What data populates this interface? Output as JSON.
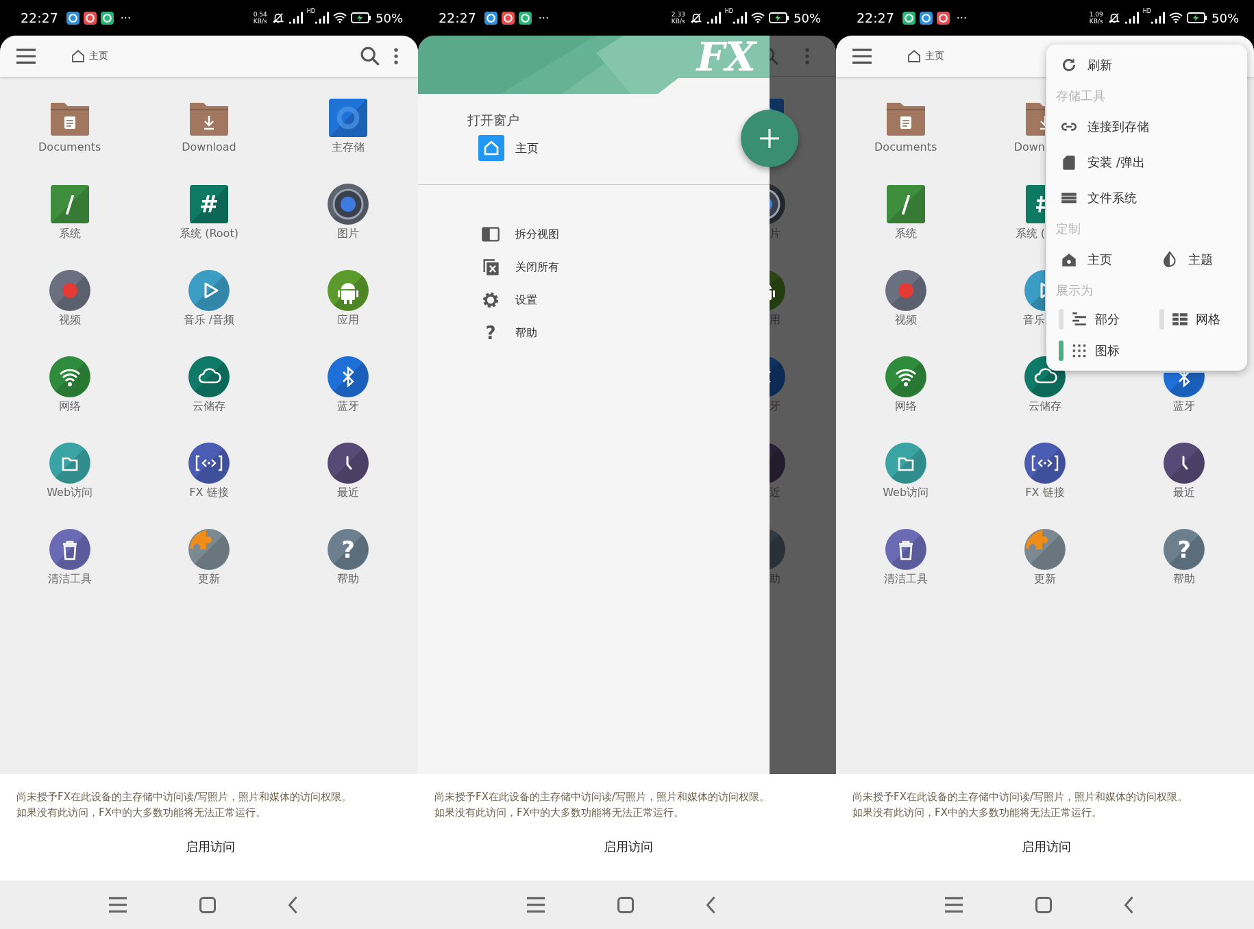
{
  "screens": [
    {
      "kind": "home",
      "status_bar": {
        "time": "22:27",
        "notifications": [
          {
            "kind": "browser"
          },
          {
            "kind": "qq"
          },
          {
            "kind": "cleaner"
          }
        ],
        "more": "···",
        "speed_value": "0.54",
        "speed_unit": "KB/s",
        "network_label": "HD",
        "battery": "50%"
      },
      "app_bar": {
        "title": "主页"
      },
      "grid": {
        "columns": [
          [
            {
              "label": "Documents",
              "kind": "folder-doc",
              "color": "#a1775f"
            },
            {
              "label": "系统",
              "kind": "tile-slash",
              "color": "#3e8e3e",
              "glyph": "/"
            },
            {
              "label": "视频",
              "kind": "circle-record",
              "color": "#6b7080"
            },
            {
              "label": "网络",
              "kind": "circle-wifi",
              "color": "#2f8c3c"
            },
            {
              "label": "Web访问",
              "kind": "circle-folder",
              "color": "#3aa3a3"
            },
            {
              "label": "清洁工具",
              "kind": "circle-trash",
              "color": "#6b6bb5"
            }
          ],
          [
            {
              "label": "Download",
              "kind": "folder-download",
              "color": "#a1775f"
            },
            {
              "label": "系统 (Root)",
              "kind": "tile-hash",
              "color": "#0e7a63",
              "glyph": "#"
            },
            {
              "label": "音乐 /音频",
              "kind": "circle-play",
              "color": "#3b9cc4"
            },
            {
              "label": "云储存",
              "kind": "circle-cloud",
              "color": "#0f7a68"
            },
            {
              "label": "FX 链接",
              "kind": "circle-code",
              "color": "#4a5db3"
            },
            {
              "label": "更新",
              "kind": "circle-puzzle",
              "color": "#7b8a92"
            }
          ],
          [
            {
              "label": "主存储",
              "kind": "tile-storage",
              "color": "#1f72d6"
            },
            {
              "label": "图片",
              "kind": "circle-camera",
              "color": "#5c6470"
            },
            {
              "label": "应用",
              "kind": "circle-android",
              "color": "#5b9b2b"
            },
            {
              "label": "蓝牙",
              "kind": "circle-bluetooth",
              "color": "#1f6fd8"
            },
            {
              "label": "最近",
              "kind": "circle-clock",
              "color": "#584a77"
            },
            {
              "label": "帮助",
              "kind": "circle-question",
              "color": "#6b7f8f",
              "glyph": "?"
            }
          ]
        ]
      },
      "banner": {
        "message_lines": [
          "尚未授予FX在此设备的主存储中访问读/写照片，照片和媒体的访问权限。",
          "如果没有此访问，FX中的大多数功能将无法正常运行。"
        ],
        "button": "启用访问"
      }
    },
    {
      "kind": "drawer",
      "status_bar": {
        "time": "22:27",
        "notifications": [
          {
            "kind": "browser"
          },
          {
            "kind": "qq"
          },
          {
            "kind": "cleaner"
          }
        ],
        "more": "···",
        "speed_value": "2.33",
        "speed_unit": "KB/s",
        "network_label": "HD",
        "battery": "50%"
      },
      "drawer": {
        "logo": "FX",
        "section": "打开窗户",
        "windows": [
          {
            "label": "主页"
          }
        ],
        "actions": [
          {
            "kind": "split",
            "label": "拆分视图"
          },
          {
            "kind": "close-all",
            "label": "关闭所有"
          },
          {
            "kind": "gear",
            "label": "设置"
          },
          {
            "kind": "help",
            "glyph": "?",
            "label": "帮助"
          }
        ]
      },
      "background_column": [
        {
          "kind": "tile-storage",
          "color": "#0e3360"
        },
        {
          "kind": "circle-camera",
          "color": "#292d32",
          "label": "片"
        },
        {
          "kind": "circle-android",
          "color": "#294613",
          "label": "用"
        },
        {
          "kind": "circle-bluetooth",
          "color": "#0e3261",
          "label": "牙"
        },
        {
          "kind": "circle-clock",
          "color": "#282135",
          "label": "近"
        },
        {
          "kind": "circle-question",
          "color": "#303940",
          "label": "助"
        }
      ],
      "banner": {
        "message_lines": [
          "尚未授予FX在此设备的主存储中访问读/写照片，照片和媒体的访问权限。",
          "如果没有此访问，FX中的大多数功能将无法正常运行。"
        ],
        "button": "启用访问"
      }
    },
    {
      "kind": "menu",
      "status_bar": {
        "time": "22:27",
        "notifications": [
          {
            "kind": "cleaner"
          },
          {
            "kind": "browser"
          },
          {
            "kind": "qq"
          }
        ],
        "more": "···",
        "speed_value": "1.09",
        "speed_unit": "KB/s",
        "network_label": "HD",
        "battery": "50%"
      },
      "app_bar": {
        "title": "主页"
      },
      "grid": {
        "columns": [
          [
            {
              "label": "Documents",
              "kind": "folder-doc",
              "color": "#a1775f"
            },
            {
              "label": "系统",
              "kind": "tile-slash",
              "color": "#3e8e3e",
              "glyph": "/"
            },
            {
              "label": "视频",
              "kind": "circle-record",
              "color": "#6b7080"
            },
            {
              "label": "网络",
              "kind": "circle-wifi",
              "color": "#2f8c3c"
            },
            {
              "label": "Web访问",
              "kind": "circle-folder",
              "color": "#3aa3a3"
            },
            {
              "label": "清洁工具",
              "kind": "circle-trash",
              "color": "#6b6bb5"
            }
          ],
          [
            {
              "label": "Down",
              "kind": "folder-download",
              "color": "#a1775f"
            },
            {
              "label": "系统 (",
              "kind": "tile-hash",
              "color": "#0e7a63"
            },
            {
              "label": "音乐",
              "kind": "circle-play",
              "color": "#3b9cc4"
            },
            {
              "label": "云储存",
              "kind": "circle-cloud",
              "color": "#0f7a68"
            },
            {
              "label": "FX 链接",
              "kind": "circle-code",
              "color": "#4a5db3"
            },
            {
              "label": "更新",
              "kind": "circle-puzzle",
              "color": "#7b8a92"
            }
          ],
          [
            {
              "label": "蓝牙",
              "kind": "circle-bluetooth",
              "color": "#1f6fd8"
            },
            {
              "label": "最近",
              "kind": "circle-clock",
              "color": "#584a77"
            },
            {
              "label": "帮助",
              "kind": "circle-question",
              "color": "#6b7f8f",
              "glyph": "?"
            }
          ]
        ]
      },
      "menu": [
        {
          "kind": "refresh",
          "label": "刷新"
        },
        {
          "kind": "header",
          "label": "存储工具"
        },
        {
          "kind": "link",
          "label": "连接到存储"
        },
        {
          "kind": "sd-card",
          "label": "安装 /弹出"
        },
        {
          "kind": "storage",
          "label": "文件系统"
        },
        {
          "kind": "header",
          "label": "定制"
        },
        {
          "kind": "row",
          "items": [
            {
              "kind": "home-gear",
              "label": "主页"
            },
            {
              "kind": "drop",
              "label": "主题"
            }
          ]
        },
        {
          "kind": "header",
          "label": "展示为"
        },
        {
          "kind": "row",
          "items": [
            {
              "kind": "list",
              "label": "部分",
              "selected": false
            },
            {
              "kind": "grid",
              "label": "网格",
              "selected": false
            }
          ]
        },
        {
          "kind": "row",
          "items": [
            {
              "kind": "dots",
              "label": "图标",
              "selected": true
            }
          ]
        }
      ],
      "banner": {
        "message_lines": [
          "尚未授予FX在此设备的主存储中访问读/写照片，照片和媒体的访问权限。",
          "如果没有此访问，FX中的大多数功能将无法正常运行。"
        ],
        "button": "启用访问"
      }
    }
  ]
}
